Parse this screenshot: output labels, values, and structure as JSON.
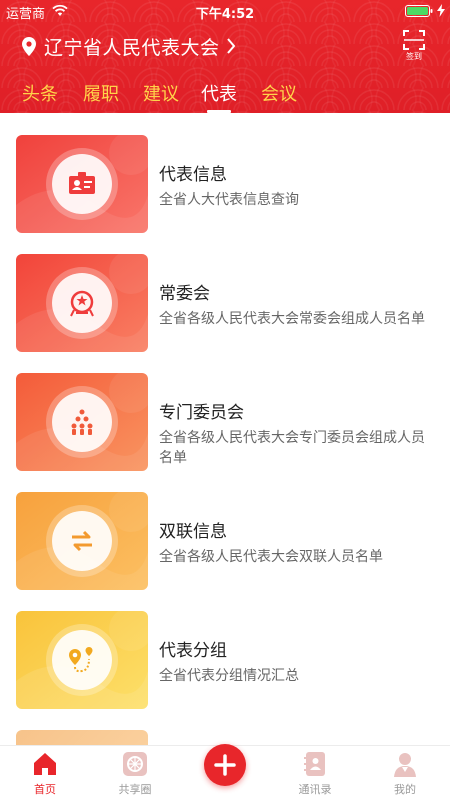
{
  "status_bar": {
    "carrier": "运营商",
    "time": "下午4:52"
  },
  "header": {
    "location_title": "辽宁省人民代表大会",
    "sign_label": "签到",
    "tabs": [
      {
        "label": "头条",
        "active": false
      },
      {
        "label": "履职",
        "active": false
      },
      {
        "label": "建议",
        "active": false
      },
      {
        "label": "代表",
        "active": true
      },
      {
        "label": "会议",
        "active": false
      }
    ]
  },
  "list": {
    "items": [
      {
        "title": "代表信息",
        "desc": "全省人大代表信息查询",
        "icon": "id-card-icon",
        "gradient": [
          "#f0413c",
          "#f9766a"
        ]
      },
      {
        "title": "常委会",
        "desc": "全省各级人民代表大会常委会组成人员名单",
        "icon": "emblem-icon",
        "gradient": [
          "#f2443a",
          "#f98063"
        ]
      },
      {
        "title": "专门委员会",
        "desc": "全省各级人民代表大会专门委员会组成人员名单",
        "icon": "group-icon",
        "gradient": [
          "#f45b3a",
          "#f99560"
        ]
      },
      {
        "title": "双联信息",
        "desc": "全省各级人民代表大会双联人员名单",
        "icon": "exchange-icon",
        "gradient": [
          "#f7a13d",
          "#fcc062"
        ]
      },
      {
        "title": "代表分组",
        "desc": "全省代表分组情况汇总",
        "icon": "route-icon",
        "gradient": [
          "#f9c33b",
          "#fde06a"
        ]
      }
    ]
  },
  "bottom_nav": {
    "items": [
      {
        "label": "首页",
        "active": true,
        "icon": "home-icon"
      },
      {
        "label": "共享圈",
        "active": false,
        "icon": "share-circle-icon"
      },
      {
        "label": "",
        "active": false,
        "icon": "add-icon"
      },
      {
        "label": "通讯录",
        "active": false,
        "icon": "contacts-icon"
      },
      {
        "label": "我的",
        "active": false,
        "icon": "profile-icon"
      }
    ]
  },
  "colors": {
    "brand_red": "#e8262b",
    "tab_inactive": "#ffd34a"
  }
}
